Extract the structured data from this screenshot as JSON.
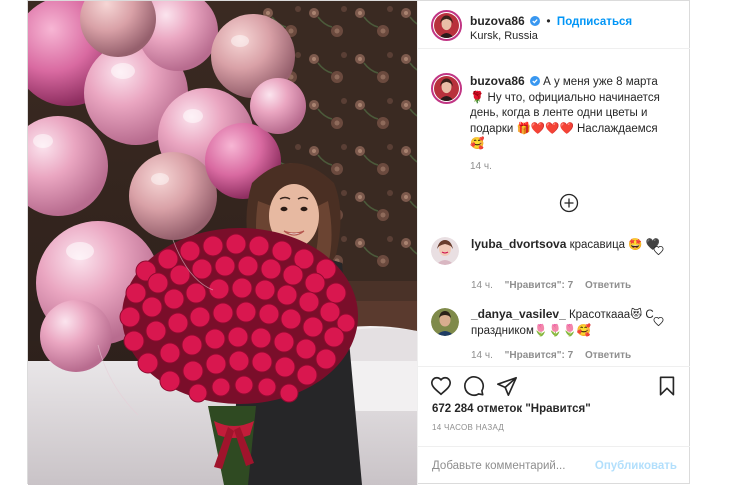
{
  "post": {
    "author": {
      "username": "buzova86",
      "verified": true,
      "follow_label": "Подписаться",
      "separator": "•",
      "location": "Kursk, Russia"
    },
    "caption": {
      "username": "buzova86",
      "text": "А у меня уже 8 марта 🌹 Ну что, официально начинается день, когда в ленте одни цветы и подарки 🎁❤️❤️❤️ Наслаждаемся 🥰",
      "time": "14 ч."
    },
    "comments": [
      {
        "username": "lyuba_dvortsova",
        "text": "красавица 🤩 🖤",
        "time": "14 ч.",
        "likes": "\"Нравится\": 7",
        "reply": "Ответить"
      },
      {
        "username": "_danya_vasilev_",
        "text": "Красоткааа😻 С праздником🌷🌷🌷🥰",
        "time": "14 ч.",
        "likes": "\"Нравится\": 7",
        "reply": "Ответить"
      }
    ],
    "likes_text": "672 284 отметок \"Нравится\"",
    "posted_ago": "14 ЧАСОВ НАЗАД",
    "add_comment": {
      "placeholder": "Добавьте комментарий...",
      "publish_label": "Опубликовать"
    }
  },
  "colors": {
    "accent": "#0095f6",
    "publish_disabled": "#b2dffc",
    "muted": "#8e8e8e",
    "border": "#dbdbdb",
    "heart_red": "#ed4956"
  },
  "icons": [
    "verified-badge-icon",
    "load-more-plus-icon",
    "heart-icon",
    "comment-icon",
    "share-icon",
    "bookmark-icon"
  ]
}
